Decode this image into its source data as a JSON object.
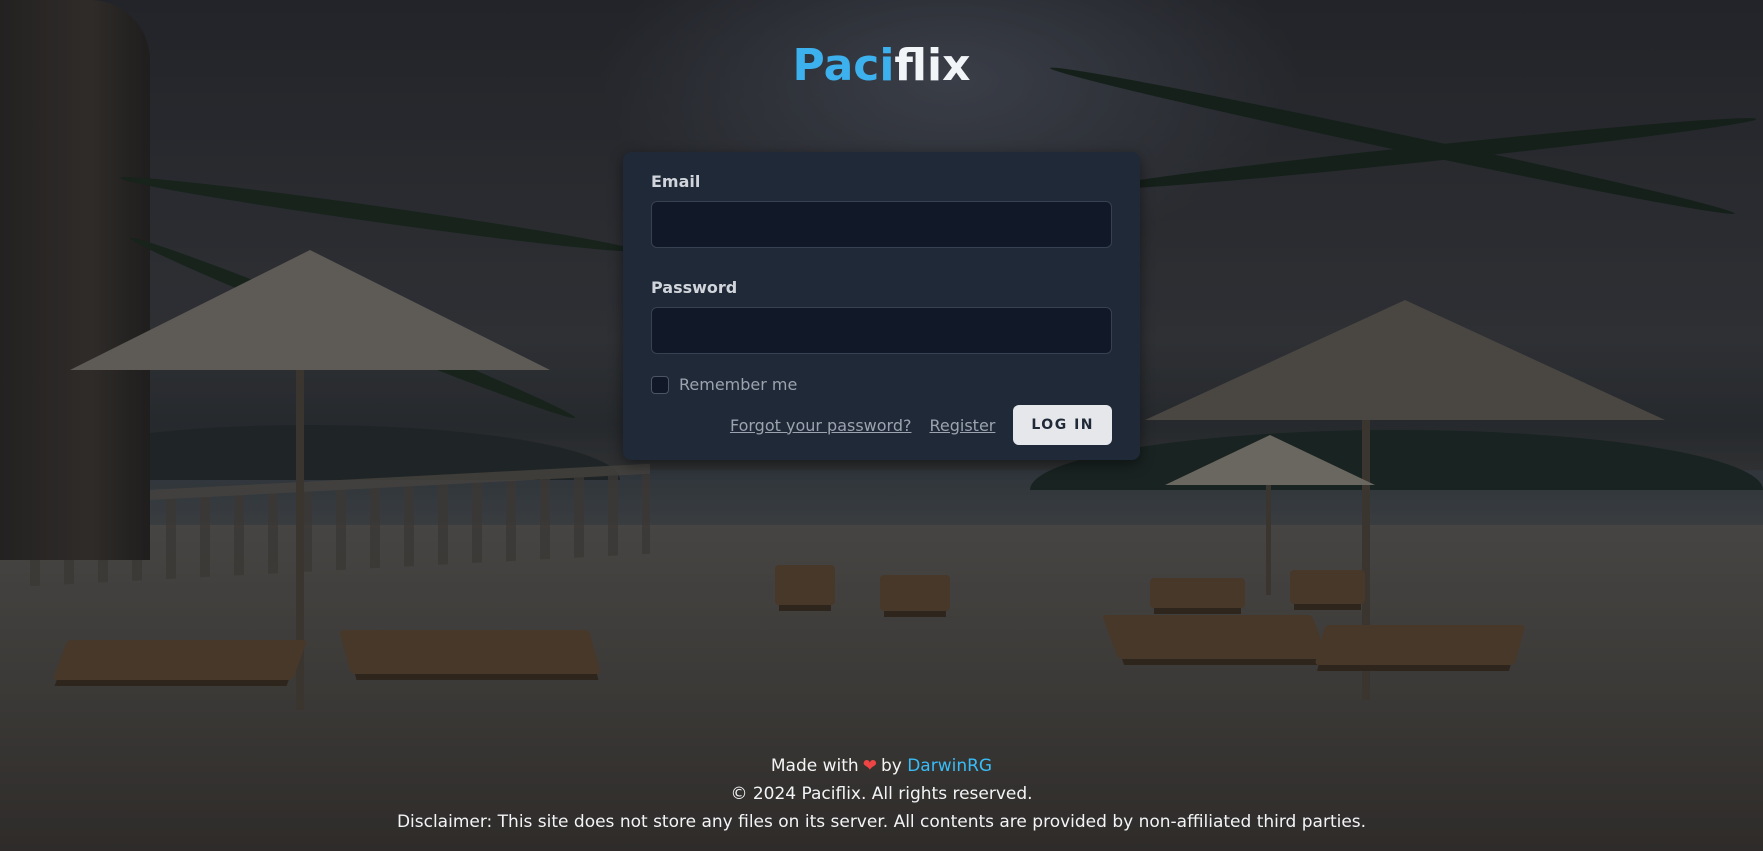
{
  "brand": {
    "part1": "Paci",
    "part2": "flix",
    "accent": "#3db1ee"
  },
  "form": {
    "email_label": "Email",
    "email_value": "",
    "password_label": "Password",
    "password_value": "",
    "remember_label": "Remember me",
    "forgot_link": "Forgot your password?",
    "register_link": "Register",
    "login_button": "LOG IN"
  },
  "footer": {
    "made_with": "Made with",
    "heart_icon": "heart-icon",
    "by": "by",
    "author": "DarwinRG",
    "copyright": "© 2024 Paciflix. All rights reserved.",
    "disclaimer": "Disclaimer: This site does not store any files on its server. All contents are provided by non-affiliated third parties."
  }
}
